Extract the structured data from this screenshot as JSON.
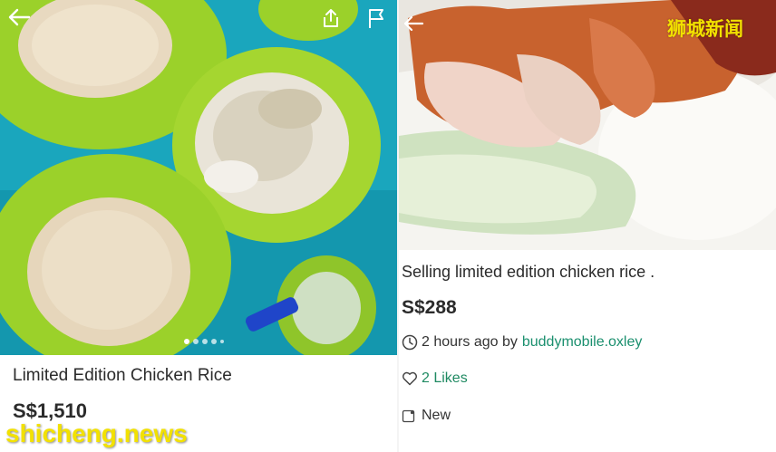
{
  "left_listing": {
    "title": "Limited Edition Chicken Rice",
    "price": "S$1,510",
    "carousel_pages": 5,
    "carousel_active": 1
  },
  "right_listing": {
    "title": "Selling limited edition chicken rice .",
    "price": "S$288",
    "time_ago": "2 hours ago by",
    "seller": "buddymobile.oxley",
    "likes": "2 Likes",
    "condition": "New"
  },
  "watermarks": {
    "top_right": "狮城新闻",
    "bottom_left": "shicheng.news"
  },
  "icons": {
    "back": "back-arrow-icon",
    "share": "share-icon",
    "report": "flag-icon",
    "clock": "clock-icon",
    "like": "heart-icon",
    "condition": "tag-icon"
  },
  "colors": {
    "text": "#2b2b2b",
    "seller_link": "#1a8f6e",
    "likes_green": "#1f8a62",
    "watermark_yellow": "#f2e100"
  }
}
